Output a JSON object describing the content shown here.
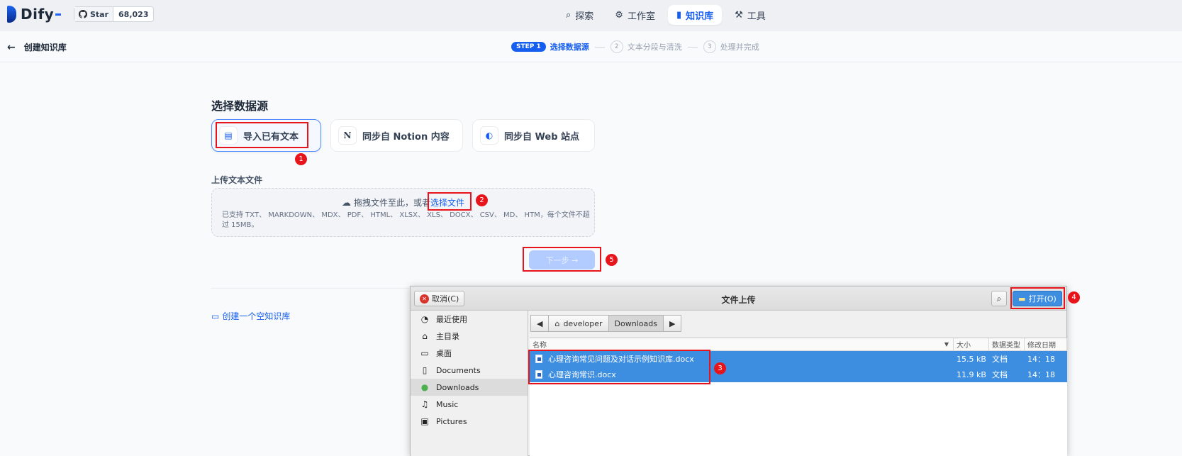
{
  "app": {
    "name": "Dify",
    "github_label": "Star",
    "github_count": "68,023"
  },
  "nav": [
    {
      "label": "探索",
      "icon": "compass-icon"
    },
    {
      "label": "工作室",
      "icon": "robot-icon"
    },
    {
      "label": "知识库",
      "icon": "book-icon",
      "active": true
    },
    {
      "label": "工具",
      "icon": "hammer-icon"
    }
  ],
  "subheader": {
    "back_label": "创建知识库",
    "steps": [
      {
        "badge": "STEP 1",
        "label": "选择数据源"
      },
      {
        "num": "2",
        "label": "文本分段与清洗"
      },
      {
        "num": "3",
        "label": "处理并完成"
      }
    ]
  },
  "main": {
    "section_title": "选择数据源",
    "sources": [
      {
        "label": "导入已有文本",
        "icon": "file-icon"
      },
      {
        "label": "同步自 Notion 内容",
        "icon": "notion-icon"
      },
      {
        "label": "同步自 Web 站点",
        "icon": "globe-icon"
      }
    ],
    "upload_title": "上传文本文件",
    "drop_text": "拖拽文件至此，或者",
    "drop_link": "选择文件",
    "drop_hint": "已支持 TXT、 MARKDOWN、 MDX、 PDF、 HTML、 XLSX、 XLS、 DOCX、 CSV、 MD、 HTM，每个文件不超过 15MB。",
    "next_label": "下一步 →",
    "empty_kb_label": "创建一个空知识库"
  },
  "annotations": [
    "1",
    "2",
    "3",
    "4",
    "5"
  ],
  "dialog": {
    "title": "文件上传",
    "cancel_label": "取消(C)",
    "open_label": "打开(O)",
    "places": [
      "最近使用",
      "主目录",
      "桌面",
      "Documents",
      "Downloads",
      "Music",
      "Pictures"
    ],
    "path": [
      "developer",
      "Downloads"
    ],
    "columns": {
      "name": "名称",
      "size": "大小",
      "type": "数据类型",
      "date": "修改日期"
    },
    "files": [
      {
        "name": "心理咨询常见问题及对话示例知识库.docx",
        "size": "15.5 kB",
        "type": "文档",
        "date": "14：18"
      },
      {
        "name": "心理咨询常识.docx",
        "size": "11.9 kB",
        "type": "文档",
        "date": "14：18"
      }
    ]
  },
  "colors": {
    "accent": "#155eef",
    "annotation": "#e8141b",
    "selection": "#3d8ee0"
  }
}
